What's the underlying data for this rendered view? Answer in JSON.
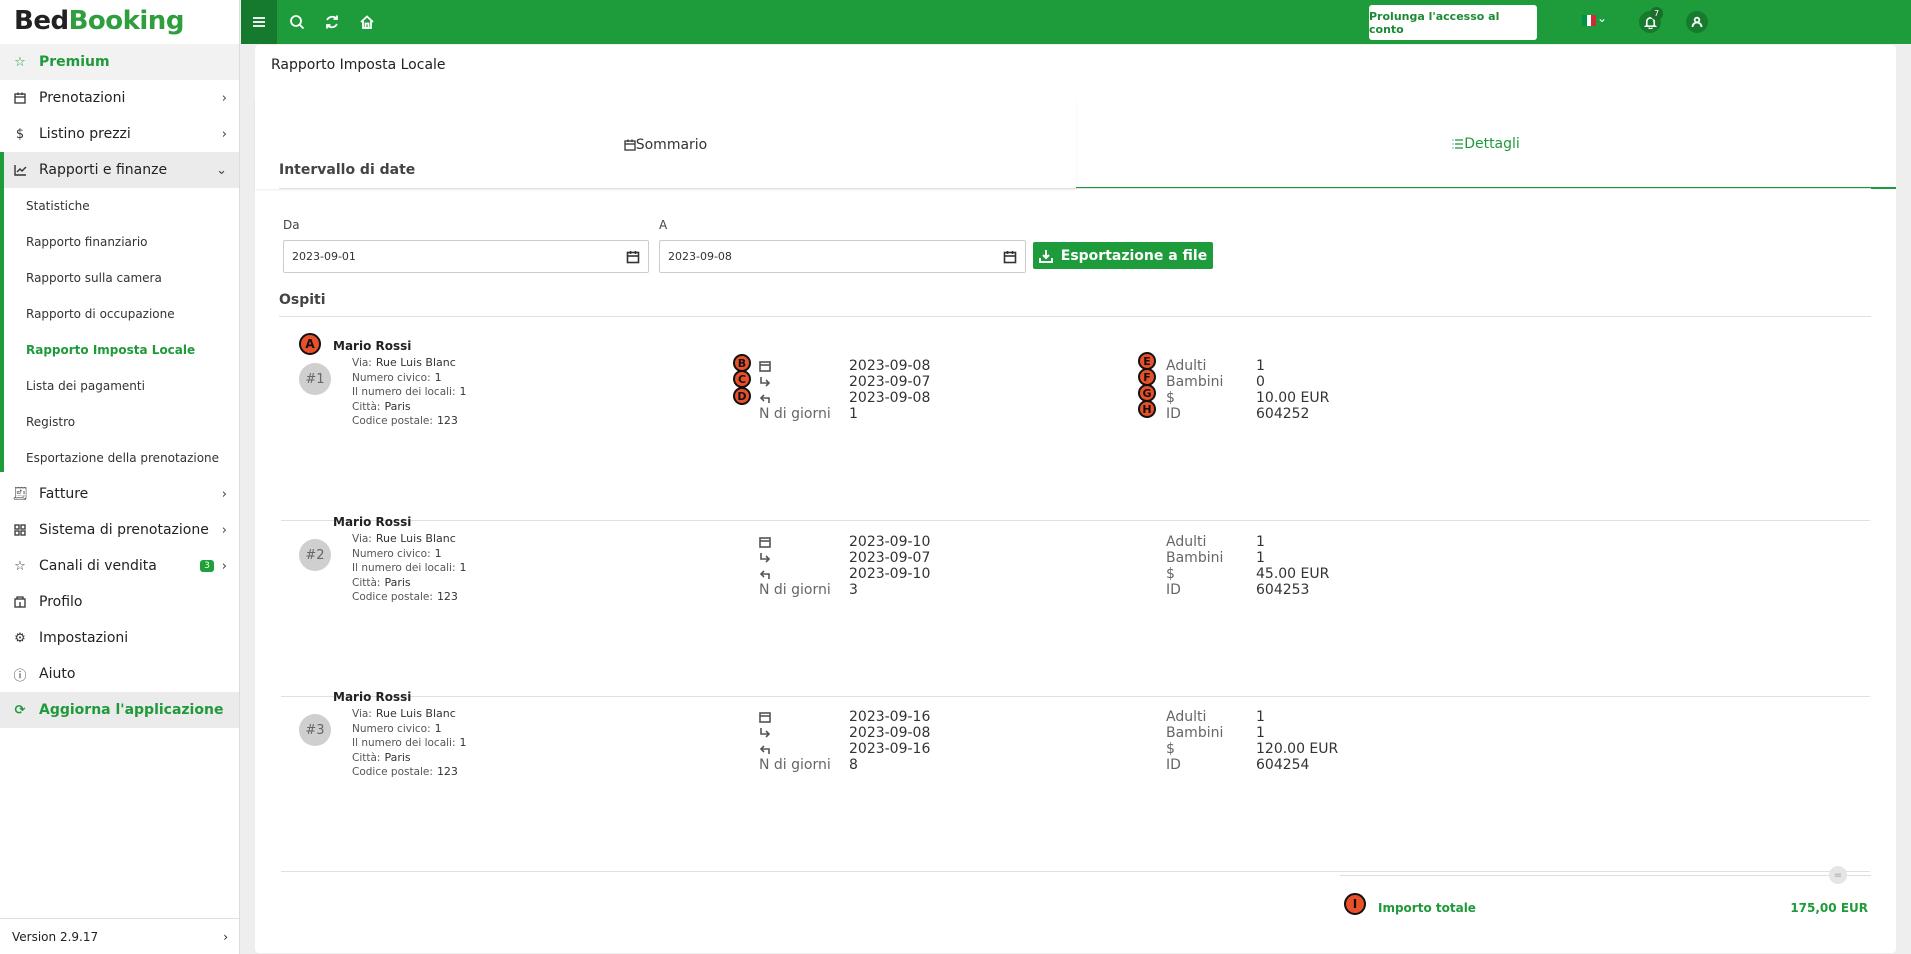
{
  "app": {
    "brand_part1": "Bed",
    "brand_part2": "Booking"
  },
  "sidebar": {
    "premium": "Premium",
    "items": [
      {
        "label": "Prenotazioni"
      },
      {
        "label": "Listino prezzi"
      },
      {
        "label": "Rapporti e finanze"
      }
    ],
    "subitems": [
      "Statistiche",
      "Rapporto finanziario",
      "Rapporto sulla camera",
      "Rapporto di occupazione",
      "Rapporto Imposta Locale",
      "Lista dei pagamenti",
      "Registro",
      "Esportazione della prenotazione"
    ],
    "items2": [
      {
        "label": "Fatture"
      },
      {
        "label": "Sistema di prenotazione"
      },
      {
        "label": "Canali di vendita",
        "badge": "3"
      },
      {
        "label": "Profilo"
      },
      {
        "label": "Impostazioni"
      },
      {
        "label": "Aiuto"
      }
    ],
    "update": "Aggiorna l'applicazione",
    "version": "Version 2.9.17"
  },
  "topbar": {
    "extend_label": "Prolunga l'accesso al conto",
    "notifications_count": "7",
    "flag_colors": [
      "#009246",
      "#ffffff",
      "#ce2b37"
    ]
  },
  "page": {
    "title": "Rapporto Imposta Locale",
    "tabs": [
      "Sommario",
      "Dettagli"
    ],
    "active_tab": "Dettagli",
    "date_section": "Intervallo di date",
    "from_label": "Da",
    "from_value": "2023-09-01",
    "to_label": "A",
    "to_value": "2023-09-08",
    "export_label": "Esportazione a file",
    "guests_section": "Ospiti"
  },
  "labels": {
    "via": "Via:",
    "civic": "Numero civico:",
    "premises": "Il numero dei locali:",
    "city": "Città:",
    "postal": "Codice postale:",
    "days": "N di giorni",
    "adults": "Adulti",
    "children": "Bambini",
    "money": "$",
    "id": "ID"
  },
  "guests": [
    {
      "num": "#1",
      "name": "Mario Rossi",
      "via": "Rue Luis Blanc",
      "civic": "1",
      "premises": "1",
      "city": "Paris",
      "postal": "123",
      "date": "2023-09-08",
      "checkin": "2023-09-07",
      "checkout": "2023-09-08",
      "days": "1",
      "adults": "1",
      "children": "0",
      "amount": "10.00 EUR",
      "id": "604252"
    },
    {
      "num": "#2",
      "name": "Mario Rossi",
      "via": "Rue Luis Blanc",
      "civic": "1",
      "premises": "1",
      "city": "Paris",
      "postal": "123",
      "date": "2023-09-10",
      "checkin": "2023-09-07",
      "checkout": "2023-09-10",
      "days": "3",
      "adults": "1",
      "children": "1",
      "amount": "45.00 EUR",
      "id": "604253"
    },
    {
      "num": "#3",
      "name": "Mario Rossi",
      "via": "Rue Luis Blanc",
      "civic": "1",
      "premises": "1",
      "city": "Paris",
      "postal": "123",
      "date": "2023-09-16",
      "checkin": "2023-09-08",
      "checkout": "2023-09-16",
      "days": "8",
      "adults": "1",
      "children": "1",
      "amount": "120.00 EUR",
      "id": "604254"
    }
  ],
  "markers": {
    "a": "A",
    "b": "B",
    "c": "C",
    "d": "D",
    "e": "E",
    "f": "F",
    "g": "G",
    "h": "H",
    "i": "I"
  },
  "total": {
    "label": "Importo totale",
    "value": "175,00 EUR"
  }
}
